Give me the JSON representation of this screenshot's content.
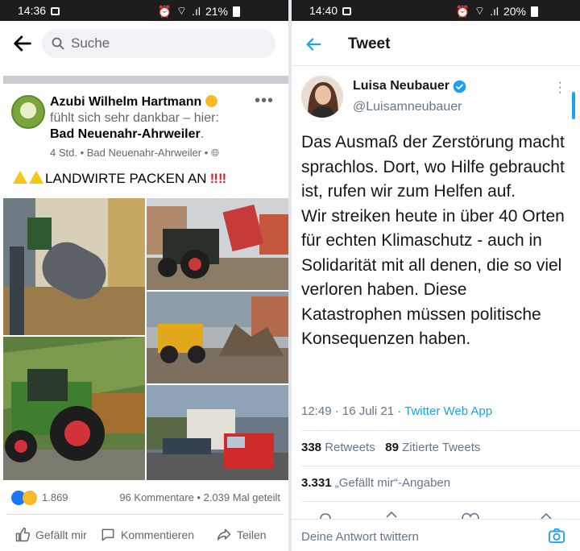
{
  "left": {
    "status": {
      "time": "14:36",
      "battery": "21%"
    },
    "search": {
      "placeholder": "Suche"
    },
    "post": {
      "author": "Azubi Wilhelm Hartmann",
      "feeling": "fühlt sich sehr dankbar – hier:",
      "place": "Bad Neuenahr-Ahrweiler",
      "meta": "4 Std. • Bad Neuenahr-Ahrweiler •",
      "text": "LANDWIRTE PACKEN AN",
      "reaction_count": "1.869",
      "stats": "96 Kommentare • 2.039 Mal geteilt"
    },
    "actions": {
      "like": "Gefällt mir",
      "comment": "Kommentieren",
      "share": "Teilen"
    },
    "colors": {
      "accent": "#1877f2",
      "text": "#050505",
      "muted": "#65676b"
    }
  },
  "right": {
    "status": {
      "time": "14:40",
      "battery": "20%"
    },
    "header": {
      "title": "Tweet"
    },
    "tweet": {
      "name": "Luisa Neubauer",
      "handle": "@Luisamneubauer",
      "text": "Das Ausmaß der Zerstörung macht sprachlos. Dort, wo Hilfe gebraucht ist, rufen wir zum Helfen auf.\nWir streiken heute in über 40 Orten für echten Klimaschutz - auch in Solidarität mit all denen, die so viel verloren haben. Diese Katastrophen müssen politische Konsequenzen haben.",
      "time": "12:49 · 16 Juli 21 · ",
      "app": "Twitter Web App",
      "retweets_count": "338",
      "retweets_label": " Retweets",
      "quotes_count": "89",
      "quotes_label": " Zitierte Tweets",
      "likes_count": "3.331",
      "likes_label": " „Gefällt mir“-Angaben"
    },
    "reply": {
      "placeholder": "Deine Antwort twittern"
    },
    "colors": {
      "accent": "#1da1f2",
      "text": "#14171a",
      "muted": "#657786"
    }
  }
}
